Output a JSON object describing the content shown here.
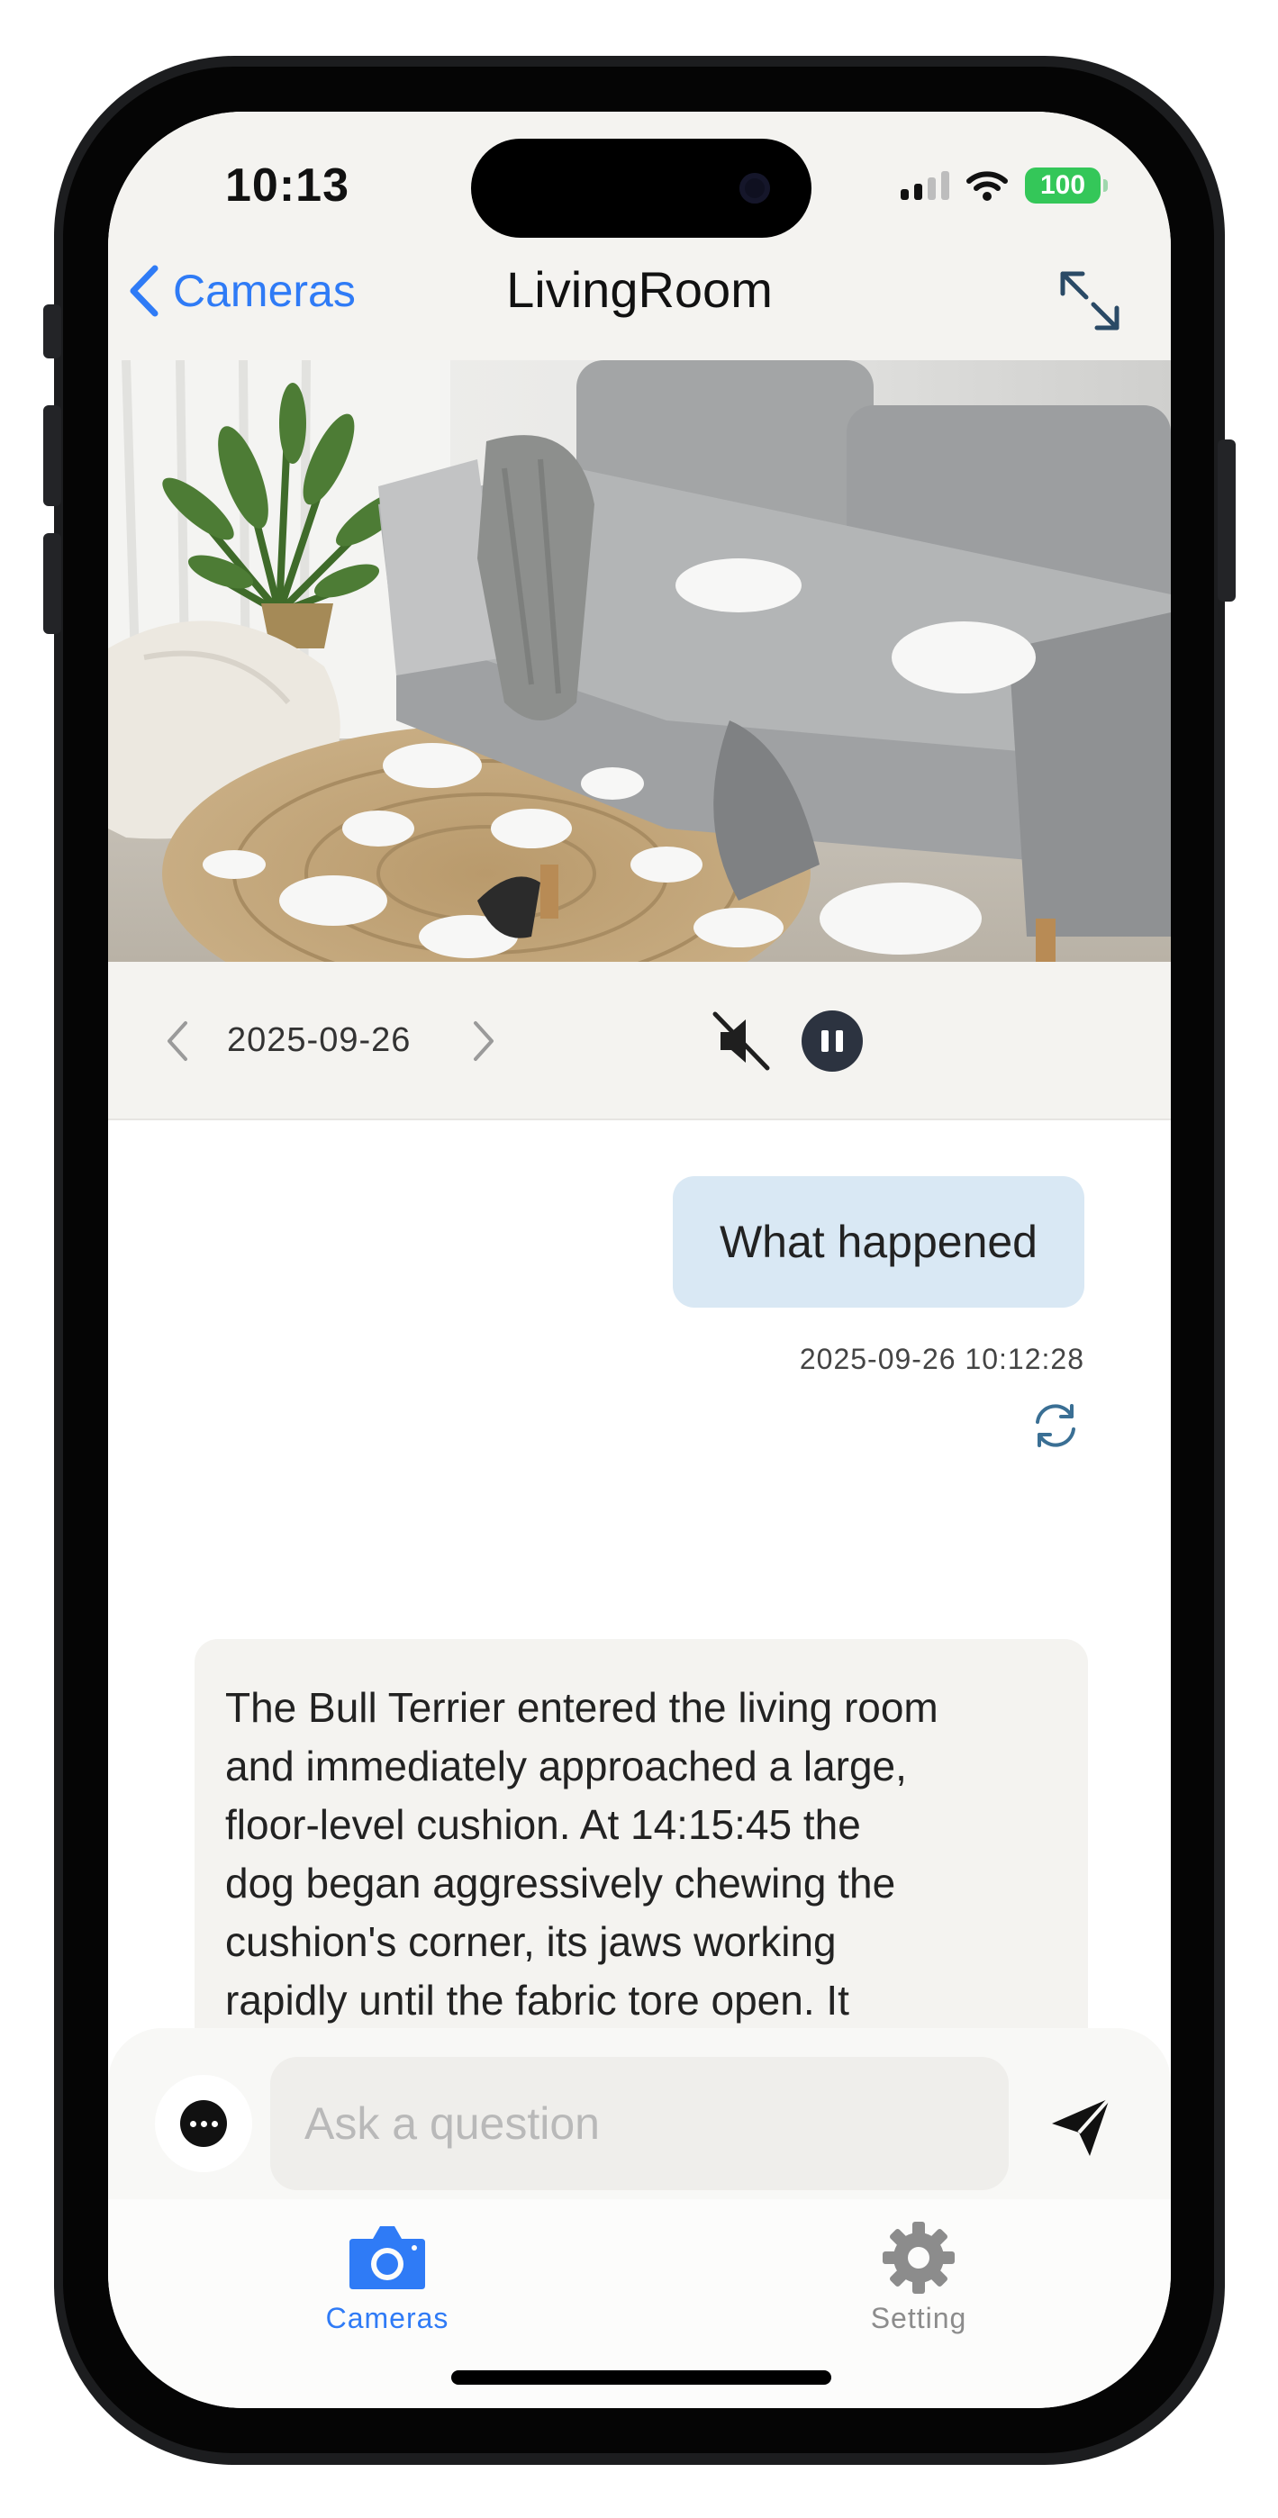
{
  "status_bar": {
    "time": "10:13",
    "battery": "100",
    "icons": [
      "signal-icon",
      "wifi-icon",
      "battery-icon"
    ]
  },
  "nav": {
    "back_label": "Cameras",
    "title": "LivingRoom",
    "expand_icon": "expand-icon",
    "accent_color": "#2f7bf6"
  },
  "camera_view": {
    "scene": "living-room-camera-frame"
  },
  "playback": {
    "date": "2025-09-26",
    "prev_icon": "chevron-left-icon",
    "next_icon": "chevron-right-icon",
    "mute_icon": "speaker-muted-icon",
    "pause_icon": "pause-icon"
  },
  "chat": {
    "messages": [
      {
        "role": "user",
        "text": "What happened",
        "timestamp": "2025-09-26 10:12:28"
      },
      {
        "role": "assistant",
        "lines": [
          "The Bull Terrier entered the living room",
          "and immediately approached a large,",
          "floor-level cushion. At 14:15:45 the",
          "dog began aggressively chewing the",
          "cushion's corner, its jaws working",
          "rapidly until the fabric tore open. It"
        ]
      }
    ],
    "regenerate_icon": "refresh-icon"
  },
  "input": {
    "placeholder": "Ask a question",
    "value": "",
    "more_icon": "more-icon",
    "send_icon": "send-icon"
  },
  "tabs": [
    {
      "label": "Cameras",
      "icon": "camera-icon",
      "active": true,
      "color": "#2f7bf6"
    },
    {
      "label": "Setting",
      "icon": "gear-icon",
      "active": false,
      "color": "#8c8c8c"
    }
  ]
}
